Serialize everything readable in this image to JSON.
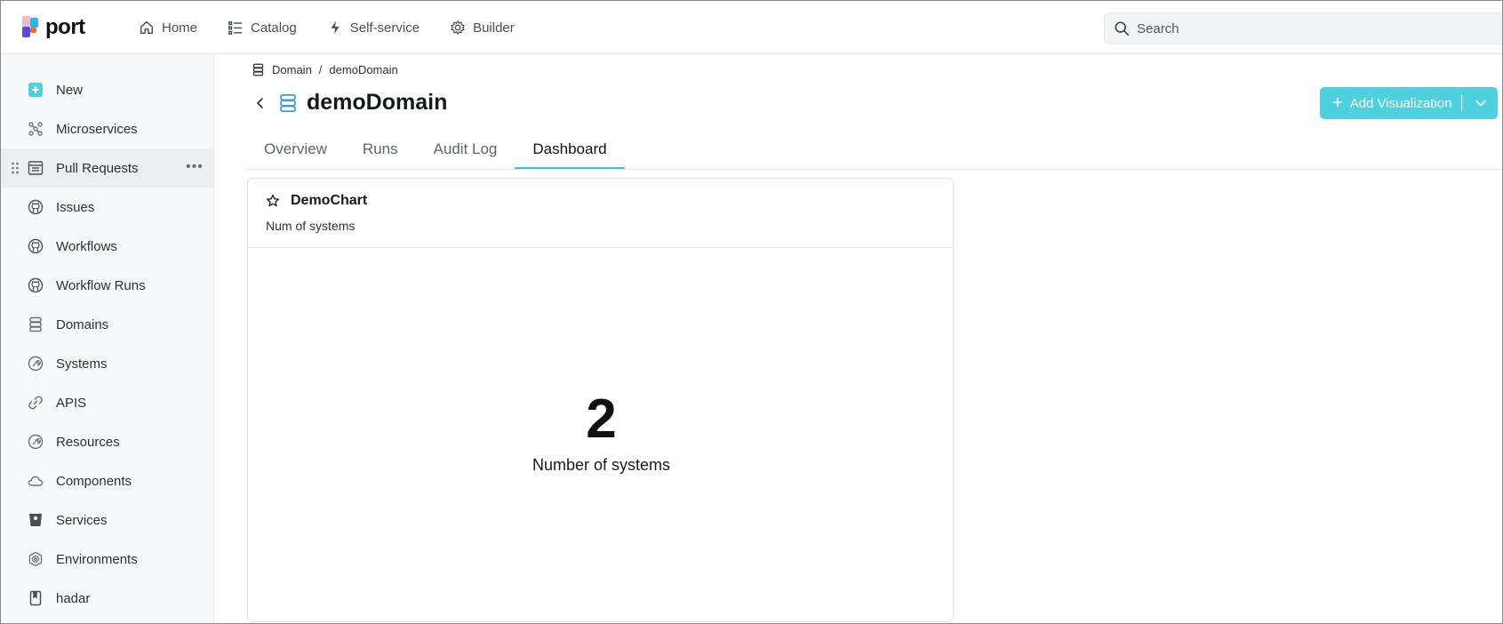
{
  "app": {
    "logo_text": "port"
  },
  "nav": {
    "items": [
      {
        "label": "Home",
        "icon": "home-icon"
      },
      {
        "label": "Catalog",
        "icon": "list-icon"
      },
      {
        "label": "Self-service",
        "icon": "bolt-icon"
      },
      {
        "label": "Builder",
        "icon": "gear-icon"
      }
    ]
  },
  "search": {
    "placeholder": "Search"
  },
  "sidebar": {
    "items": [
      {
        "label": "New",
        "icon": "plus-square-icon"
      },
      {
        "label": "Microservices",
        "icon": "microservices-icon"
      },
      {
        "label": "Pull Requests",
        "icon": "table-icon",
        "active": true
      },
      {
        "label": "Issues",
        "icon": "github-icon"
      },
      {
        "label": "Workflows",
        "icon": "github-icon"
      },
      {
        "label": "Workflow Runs",
        "icon": "github-icon"
      },
      {
        "label": "Domains",
        "icon": "database-icon"
      },
      {
        "label": "Systems",
        "icon": "system-icon"
      },
      {
        "label": "APIS",
        "icon": "link-icon"
      },
      {
        "label": "Resources",
        "icon": "system-icon"
      },
      {
        "label": "Components",
        "icon": "cloud-icon"
      },
      {
        "label": "Services",
        "icon": "bucket-icon"
      },
      {
        "label": "Environments",
        "icon": "environment-icon"
      },
      {
        "label": "hadar",
        "icon": "book-icon"
      }
    ],
    "more_label": "•••"
  },
  "breadcrumb": {
    "parent": "Domain",
    "separator": "/",
    "current": "demoDomain"
  },
  "page": {
    "title": "demoDomain"
  },
  "tabs": [
    {
      "label": "Overview",
      "active": false
    },
    {
      "label": "Runs",
      "active": false
    },
    {
      "label": "Audit Log",
      "active": false
    },
    {
      "label": "Dashboard",
      "active": true
    }
  ],
  "toolbar": {
    "add_visualization_label": "Add Visualization"
  },
  "widget": {
    "title": "DemoChart",
    "description": "Num of systems",
    "value": "2",
    "value_label": "Number of systems"
  },
  "colors": {
    "accent": "#4fd0df",
    "tab_underline": "#3fc1d6",
    "domain_icon": "#3b9ae1"
  }
}
